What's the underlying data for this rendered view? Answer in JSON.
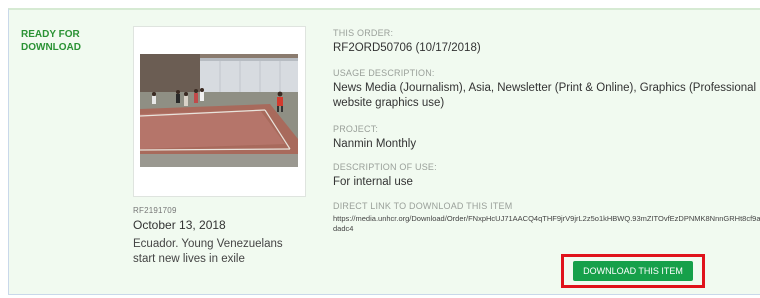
{
  "status_label": "READY FOR DOWNLOAD",
  "item": {
    "id": "RF2191709",
    "date": "October 13, 2018",
    "caption": "Ecuador. Young Venezuelans start new lives in exile"
  },
  "order": {
    "label": "THIS ORDER:",
    "value": "RF2ORD50706  (10/17/2018)"
  },
  "usage": {
    "label": "USAGE DESCRIPTION:",
    "value": "News Media (Journalism), Asia, Newsletter (Print & Online), Graphics (Professional website graphics use)"
  },
  "project": {
    "label": "PROJECT:",
    "value": "Nanmin Monthly"
  },
  "description_of_use": {
    "label": "DESCRIPTION OF USE:",
    "value": "For internal use"
  },
  "direct_link": {
    "label": "DIRECT LINK TO DOWNLOAD THIS ITEM",
    "value": "https://media.unhcr.org/Download/Order/FNxpHcUJ71AACQ4qTHF9jrV9jrL2z5o1kHBWQ.93mZITOvfEzDPNMK8NnnGRHt8cf9ae1dadc4"
  },
  "download_button_label": "DOWNLOAD THIS ITEM",
  "colors": {
    "status_green": "#2a9234",
    "button_green": "#16a04a",
    "highlight_red": "#e0121b",
    "panel_bg": "#f1faf0"
  }
}
